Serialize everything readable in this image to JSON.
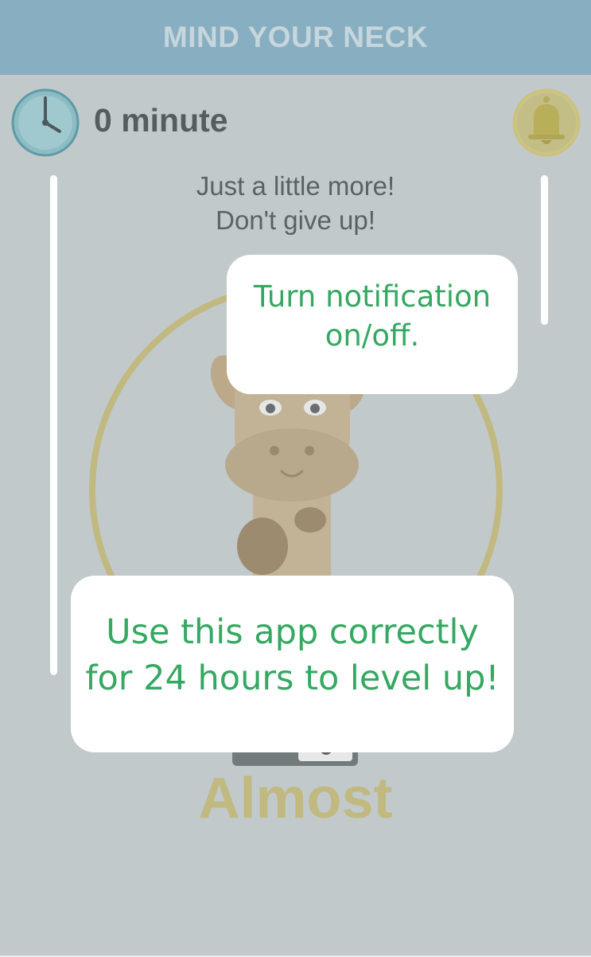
{
  "header": {
    "title": "MIND YOUR NECK"
  },
  "timer": {
    "value": "0 minute",
    "icon": "clock-icon"
  },
  "notification_button": {
    "icon": "bell-icon"
  },
  "status": {
    "message_line1": "Just a little more!",
    "message_line2": "Don't give up!",
    "level_word": "Almost"
  },
  "tooltips": {
    "notification": {
      "line1": "Turn notification",
      "line2": "on/off."
    },
    "level_up": {
      "line1": "Use this app correctly",
      "line2": "for 24 hours to level up!"
    }
  },
  "colors": {
    "header_bg": "#88aec1",
    "background": "#c1c9cb",
    "accent_gold": "#c1b980",
    "tooltip_text": "#35a862",
    "clock_teal": "#8cbcc4"
  }
}
